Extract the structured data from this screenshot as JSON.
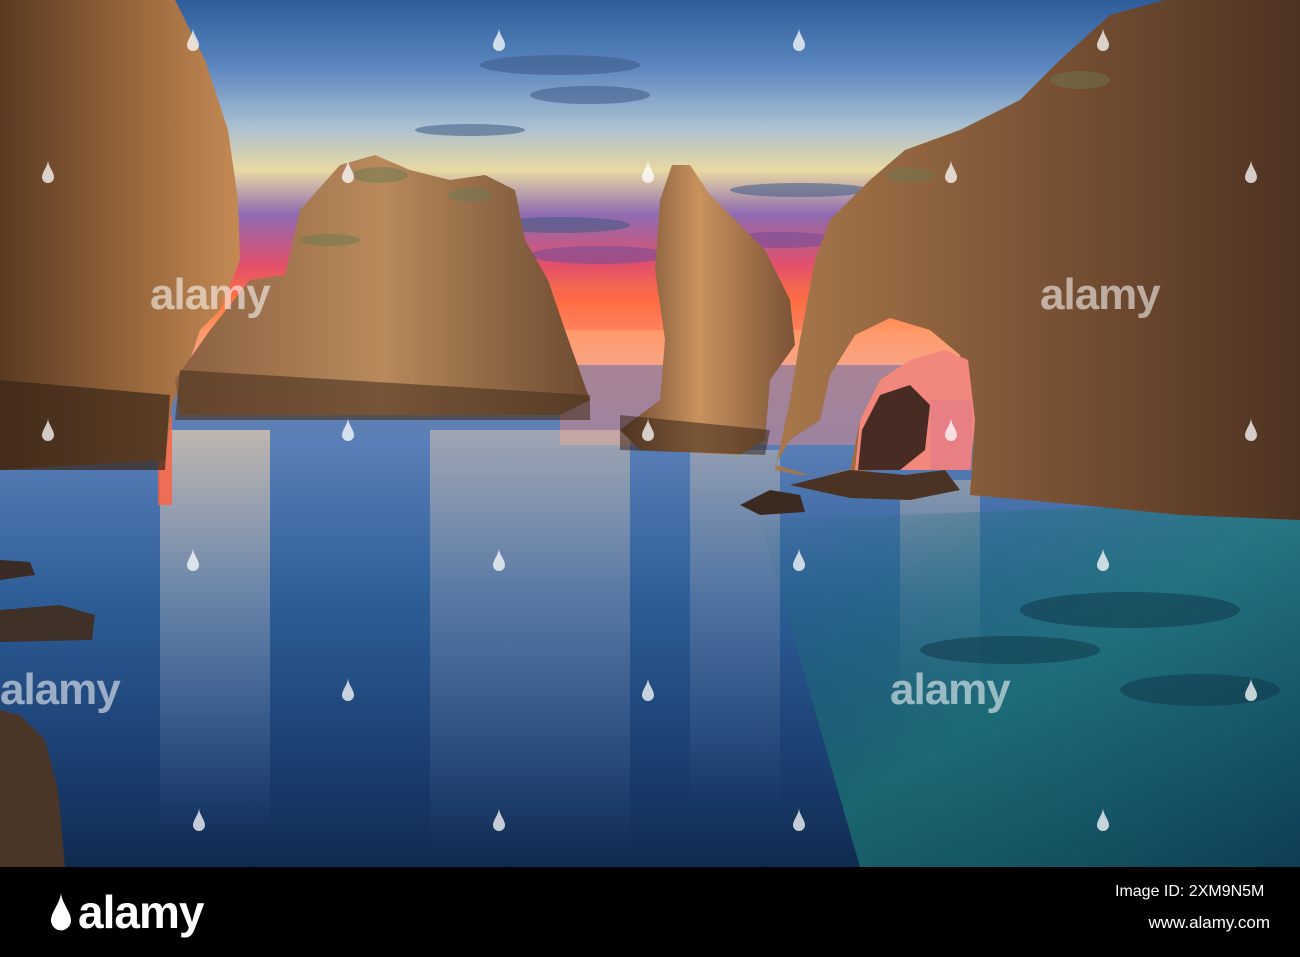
{
  "photo": {
    "subject": "Sea stacks and rock arch at sunrise"
  },
  "watermark": {
    "word": "alamy"
  },
  "footer": {
    "brand": "alamy",
    "image_id": "Image ID: 2XM9N5M",
    "site": "www.alamy.com"
  }
}
